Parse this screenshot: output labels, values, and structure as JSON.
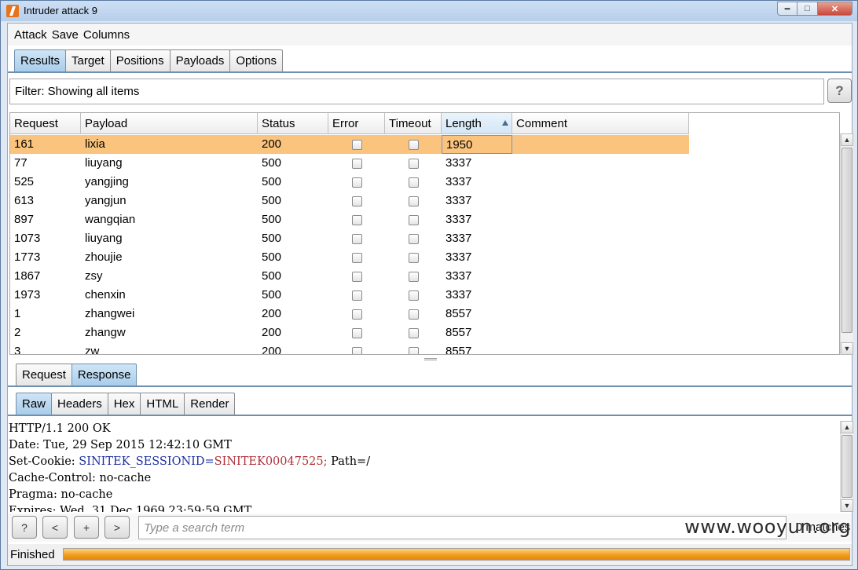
{
  "window": {
    "title": "Intruder attack 9",
    "buttons": [
      "minimize-icon",
      "maximize-icon",
      "close-icon"
    ]
  },
  "menu": [
    "Attack",
    "Save",
    "Columns"
  ],
  "top_tabs": [
    {
      "label": "Results",
      "active": true
    },
    {
      "label": "Target",
      "active": false
    },
    {
      "label": "Positions",
      "active": false
    },
    {
      "label": "Payloads",
      "active": false
    },
    {
      "label": "Options",
      "active": false
    }
  ],
  "filter": {
    "text": "Filter: Showing all items",
    "help_label": "?"
  },
  "table": {
    "columns": [
      "Request",
      "Payload",
      "Status",
      "Error",
      "Timeout",
      "Length",
      "Comment"
    ],
    "sorted_column": "Length",
    "rows": [
      {
        "request": "161",
        "payload": "lixia",
        "status": "200",
        "length": "1950",
        "selected": true
      },
      {
        "request": "77",
        "payload": "liuyang",
        "status": "500",
        "length": "3337"
      },
      {
        "request": "525",
        "payload": "yangjing",
        "status": "500",
        "length": "3337"
      },
      {
        "request": "613",
        "payload": "yangjun",
        "status": "500",
        "length": "3337"
      },
      {
        "request": "897",
        "payload": "wangqian",
        "status": "500",
        "length": "3337"
      },
      {
        "request": "1073",
        "payload": "liuyang",
        "status": "500",
        "length": "3337"
      },
      {
        "request": "1773",
        "payload": "zhoujie",
        "status": "500",
        "length": "3337"
      },
      {
        "request": "1867",
        "payload": "zsy",
        "status": "500",
        "length": "3337"
      },
      {
        "request": "1973",
        "payload": "chenxin",
        "status": "500",
        "length": "3337"
      },
      {
        "request": "1",
        "payload": "zhangwei",
        "status": "200",
        "length": "8557"
      },
      {
        "request": "2",
        "payload": "zhangw",
        "status": "200",
        "length": "8557"
      },
      {
        "request": "3",
        "payload": "zw",
        "status": "200",
        "length": "8557"
      }
    ]
  },
  "message_tabs": [
    {
      "label": "Request",
      "active": false
    },
    {
      "label": "Response",
      "active": true
    }
  ],
  "view_tabs": [
    {
      "label": "Raw",
      "active": true
    },
    {
      "label": "Headers",
      "active": false
    },
    {
      "label": "Hex",
      "active": false
    },
    {
      "label": "HTML",
      "active": false
    },
    {
      "label": "Render",
      "active": false
    }
  ],
  "raw": {
    "line1": "HTTP/1.1 200 OK",
    "line2": "Date: Tue, 29 Sep 2015 12:42:10 GMT",
    "cookie_prefix": "Set-Cookie: ",
    "cookie_name": "SINITEK_SESSIONID",
    "cookie_eq": "=",
    "cookie_value": "SINITEK00047525;",
    "cookie_suffix": " Path=/",
    "line4": "Cache-Control: no-cache",
    "line5": "Pragma: no-cache",
    "line6": "Expires: Wed, 31 Dec 1969 23:59:59 GMT"
  },
  "search": {
    "help_label": "?",
    "prev_label": "<",
    "add_label": "+",
    "next_label": ">",
    "placeholder": "Type a search term",
    "matches": "0 matches"
  },
  "status": {
    "text": "Finished",
    "progress": 1.0
  },
  "watermark": "www.wooyun.org"
}
